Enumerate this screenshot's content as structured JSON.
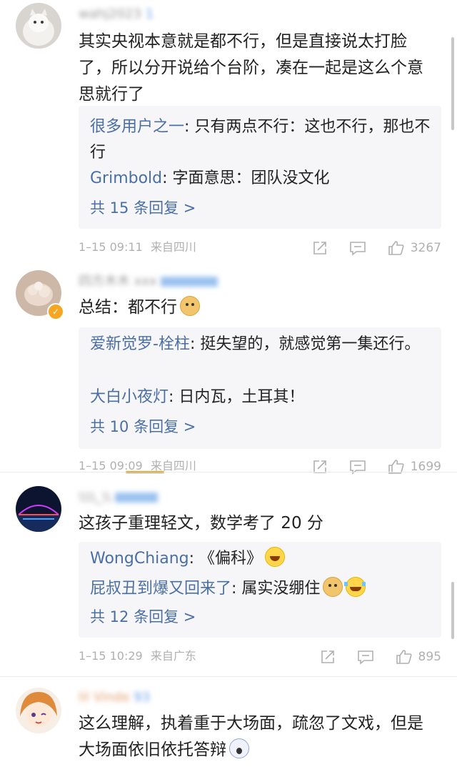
{
  "comments": [
    {
      "username_masked": "wahj2023",
      "username_tint": "1",
      "text": "其实央视本意就是都不行，但是直接说太打脸了，所以分开说给个台阶，凑在一起是这么个意思就行了",
      "replies": [
        {
          "name": "很多用户之一",
          "text": "只有两点不行：这也不行，那也不行"
        },
        {
          "name": "Grimbold",
          "text": "字面意思：团队没文化"
        }
      ],
      "more_replies": "共 15 条回复 >",
      "time": "1–15 09:11",
      "location": "来自四川",
      "likes": "3267"
    },
    {
      "username_masked": "四方木木 xxx",
      "username_tint": "",
      "text": "总结：都不行",
      "replies": [
        {
          "name": "爱新觉罗-栓柱",
          "text": "挺失望的，就感觉第一集还行。"
        },
        {
          "name": "大白小夜灯",
          "text": "日内瓦，土耳其！"
        }
      ],
      "more_replies": "共 10 条回复 >",
      "time": "1–15 09:09",
      "location": "来自四川",
      "likes": "1699"
    },
    {
      "username_masked": "\\\\\\\\_\\\\",
      "username_tint": "",
      "text": "这孩子重理轻文，数学考了 20 分",
      "replies": [
        {
          "name": "WongChiang",
          "text": "《偏科》"
        },
        {
          "name": "屁叔丑到爆又回来了",
          "text": "属实没绷住"
        }
      ],
      "more_replies": "共 12 条回复 >",
      "time": "1–15 10:29",
      "location": "来自广东",
      "likes": "895"
    },
    {
      "username_masked": "lil Vinde",
      "username_tint": "93",
      "text": "这么理解，执着重于大场面，疏忽了文戏，但是大场面依旧依托答辩",
      "replies": [],
      "more_replies": "",
      "time": "",
      "location": "",
      "likes": ""
    }
  ],
  "icons": {
    "share": "share-icon",
    "comment": "comment-icon",
    "like": "thumbs-up-icon"
  },
  "colors": {
    "link": "#4a6fa5",
    "meta": "#b0b0b0",
    "reply_bg": "#f6f6f8",
    "accent": "#ff8200"
  }
}
